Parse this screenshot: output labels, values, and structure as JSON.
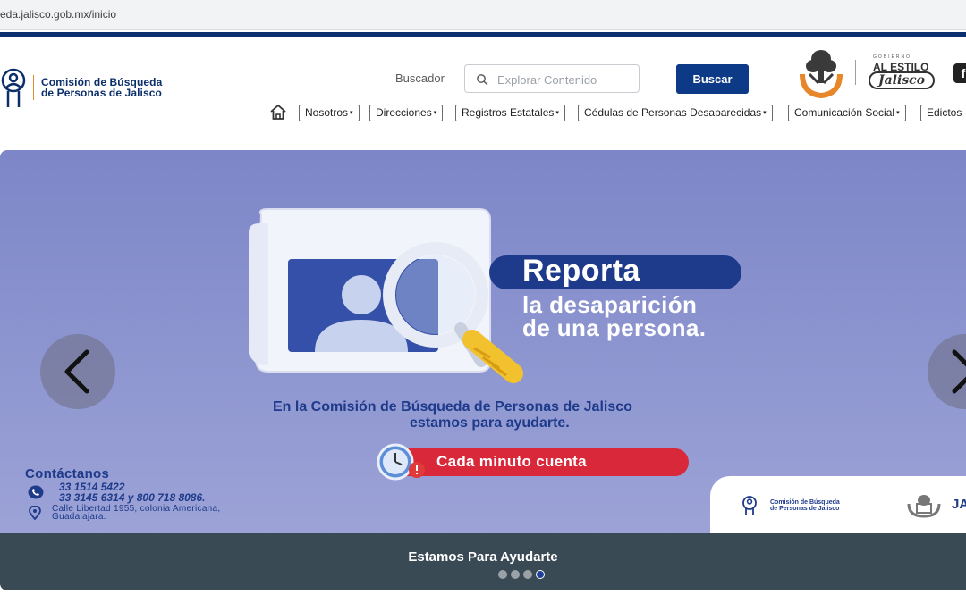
{
  "browser": {
    "url": "eda.jalisco.gob.mx/inicio"
  },
  "header": {
    "brand_line1": "Comisión de Búsqueda",
    "brand_line2": "de Personas de Jalisco",
    "search_label": "Buscador",
    "search_placeholder": "Explorar Contenido",
    "search_value": "",
    "search_button": "Buscar",
    "gov_small": "GOBIERNO",
    "gov_line1": "AL ESTILO",
    "gov_line2": "Jalisco",
    "social_fb": "f",
    "accent_color": "#0c3a86"
  },
  "nav": {
    "items": [
      {
        "label": "Nosotros",
        "has_dropdown": true
      },
      {
        "label": "Direcciones",
        "has_dropdown": true
      },
      {
        "label": "Registros Estatales",
        "has_dropdown": true
      },
      {
        "label": "Cédulas de Personas Desaparecidas",
        "has_dropdown": true
      },
      {
        "label": "Comunicación Social",
        "has_dropdown": true
      },
      {
        "label": "Edictos",
        "has_dropdown": false
      }
    ],
    "caret": "▾"
  },
  "hero": {
    "headline": "Reporta",
    "sub_line1": "la desaparición",
    "sub_line2": "de una persona.",
    "commission_line1": "En la Comisión de Búsqueda de Personas de Jalisco",
    "commission_line2": "estamos para ayudarte.",
    "cta_pill": "Cada minuto cuenta",
    "contact_title": "Contáctanos",
    "phone1": "33 1514 5422",
    "phone2": "33 3145 6314 y 800 718 8086.",
    "address1": "Calle Libertad 1955, colonia Americana,",
    "address2": "Guadalajara.",
    "footer_logo_line1": "Comisión de Búsqueda",
    "footer_logo_line2": "de Personas de Jalisco",
    "footer_ja": "JA",
    "pill_color": "#1e3a8a",
    "cta_color": "#d8283a"
  },
  "carousel": {
    "caption": "Estamos Para Ayudarte",
    "slide_count": 4,
    "active_index": 3,
    "prev_label": "previous",
    "next_label": "next"
  }
}
